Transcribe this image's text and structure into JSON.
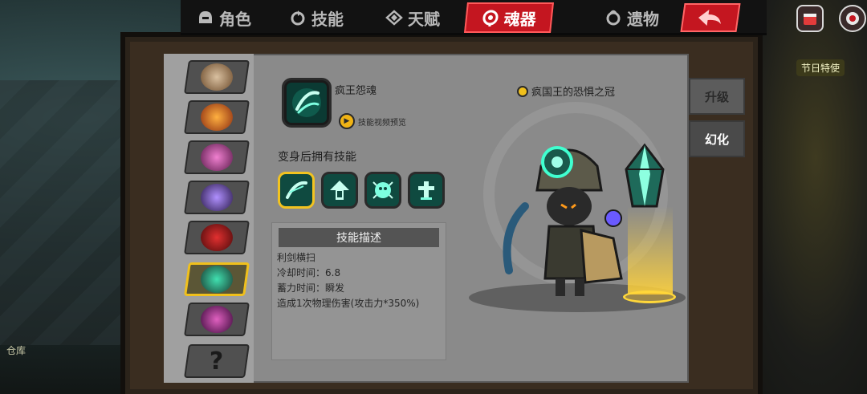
{
  "tabs": [
    {
      "label": "角色",
      "icon": "helmet-icon",
      "active": false
    },
    {
      "label": "技能",
      "icon": "skill-swirl-icon",
      "active": false
    },
    {
      "label": "天赋",
      "icon": "talent-wing-icon",
      "active": false
    },
    {
      "label": "魂器",
      "icon": "soul-spiral-icon",
      "active": true
    },
    {
      "label": "遗物",
      "icon": "relic-swirl-icon",
      "active": false
    }
  ],
  "skill": {
    "name": "疯王怨魂",
    "video_label": "技能视频预览",
    "transform_header": "变身后拥有技能",
    "icons": [
      "sword-slash-icon",
      "arrow-up-icon",
      "ghost-icon",
      "totem-icon"
    ],
    "selected_index": 0
  },
  "description": {
    "title": "技能描述",
    "lines": [
      "利剑横扫",
      "冷却时间：6.8",
      "蓄力时间：瞬发",
      "造成1次物理伤害(攻击力*350%)"
    ]
  },
  "relic": {
    "name": "疯国王的恐惧之冠"
  },
  "buttons": {
    "upgrade": "升级",
    "transform": "幻化"
  },
  "slots": {
    "count": 8,
    "selected_index": 5,
    "unknown_label": "?"
  },
  "hud": {
    "event_label": "节日特使",
    "warehouse": "仓库"
  },
  "colors": {
    "active_tab": "#c41620",
    "selected_border": "#f0c01c",
    "skill_teal": "#1fd6b0"
  }
}
